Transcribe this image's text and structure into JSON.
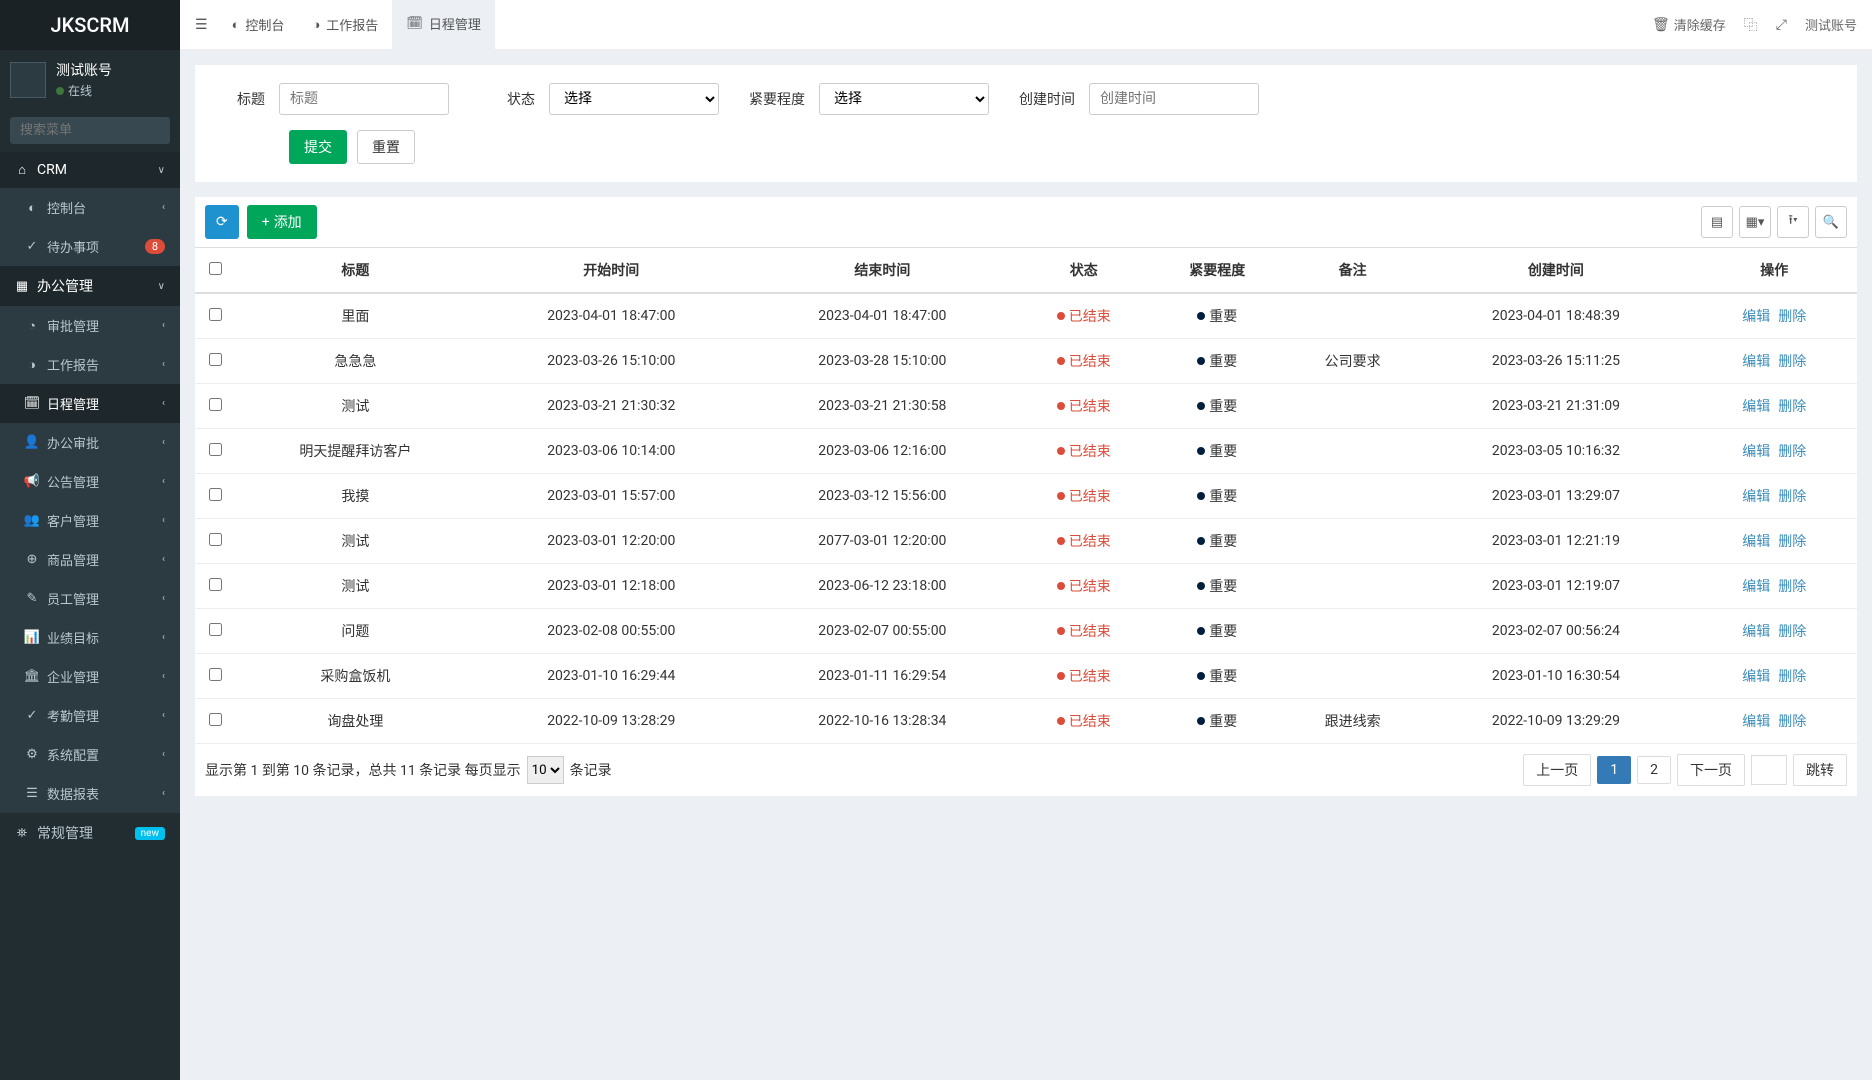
{
  "brand": "JKSCRM",
  "user": {
    "name": "测试账号",
    "status": "在线"
  },
  "search_placeholder": "搜索菜单",
  "sidebar": {
    "crm_label": "CRM",
    "crm_items": [
      {
        "label": "控制台"
      },
      {
        "label": "待办事项",
        "badge": "8"
      }
    ],
    "office_label": "办公管理",
    "office_items": [
      {
        "label": "审批管理"
      },
      {
        "label": "工作报告"
      },
      {
        "label": "日程管理",
        "active": true
      },
      {
        "label": "办公审批"
      },
      {
        "label": "公告管理"
      },
      {
        "label": "客户管理"
      },
      {
        "label": "商品管理"
      },
      {
        "label": "员工管理"
      },
      {
        "label": "业绩目标"
      },
      {
        "label": "企业管理"
      },
      {
        "label": "考勤管理"
      },
      {
        "label": "系统配置"
      },
      {
        "label": "数据报表"
      }
    ],
    "general_label": "常规管理",
    "general_badge": "new"
  },
  "topbar": {
    "tabs": [
      {
        "label": "控制台"
      },
      {
        "label": "工作报告"
      },
      {
        "label": "日程管理",
        "active": true
      }
    ],
    "clear_cache": "清除缓存",
    "account": "测试账号"
  },
  "filter": {
    "title_label": "标题",
    "title_placeholder": "标题",
    "status_label": "状态",
    "status_placeholder": "选择",
    "priority_label": "紧要程度",
    "priority_placeholder": "选择",
    "created_label": "创建时间",
    "created_placeholder": "创建时间",
    "submit": "提交",
    "reset": "重置"
  },
  "toolbar": {
    "add": "添加"
  },
  "table": {
    "cols": [
      "标题",
      "开始时间",
      "结束时间",
      "状态",
      "紧要程度",
      "备注",
      "创建时间",
      "操作"
    ],
    "status_text": "已结束",
    "priority_text": "重要",
    "edit": "编辑",
    "delete": "删除",
    "rows": [
      {
        "title": "里面",
        "start": "2023-04-01 18:47:00",
        "end": "2023-04-01 18:47:00",
        "note": "",
        "created": "2023-04-01 18:48:39"
      },
      {
        "title": "急急急",
        "start": "2023-03-26 15:10:00",
        "end": "2023-03-28 15:10:00",
        "note": "公司要求",
        "created": "2023-03-26 15:11:25"
      },
      {
        "title": "测试",
        "start": "2023-03-21 21:30:32",
        "end": "2023-03-21 21:30:58",
        "note": "",
        "created": "2023-03-21 21:31:09"
      },
      {
        "title": "明天提醒拜访客户",
        "start": "2023-03-06 10:14:00",
        "end": "2023-03-06 12:16:00",
        "note": "",
        "created": "2023-03-05 10:16:32"
      },
      {
        "title": "我摸",
        "start": "2023-03-01 15:57:00",
        "end": "2023-03-12 15:56:00",
        "note": "",
        "created": "2023-03-01 13:29:07"
      },
      {
        "title": "测试",
        "start": "2023-03-01 12:20:00",
        "end": "2077-03-01 12:20:00",
        "note": "",
        "created": "2023-03-01 12:21:19"
      },
      {
        "title": "测试",
        "start": "2023-03-01 12:18:00",
        "end": "2023-06-12 23:18:00",
        "note": "",
        "created": "2023-03-01 12:19:07"
      },
      {
        "title": "问题",
        "start": "2023-02-08 00:55:00",
        "end": "2023-02-07 00:55:00",
        "note": "",
        "created": "2023-02-07 00:56:24"
      },
      {
        "title": "采购盒饭机",
        "start": "2023-01-10 16:29:44",
        "end": "2023-01-11 16:29:54",
        "note": "",
        "created": "2023-01-10 16:30:54"
      },
      {
        "title": "询盘处理",
        "start": "2022-10-09 13:28:29",
        "end": "2022-10-16 13:28:34",
        "note": "跟进线索",
        "created": "2022-10-09 13:29:29"
      }
    ]
  },
  "pager": {
    "info_pre": "显示第 1 到第 10 条记录，总共 11 条记录 每页显示",
    "info_post": "条记录",
    "page_size": "10",
    "prev": "上一页",
    "next": "下一页",
    "jump": "跳转",
    "current": "1",
    "p2": "2"
  }
}
